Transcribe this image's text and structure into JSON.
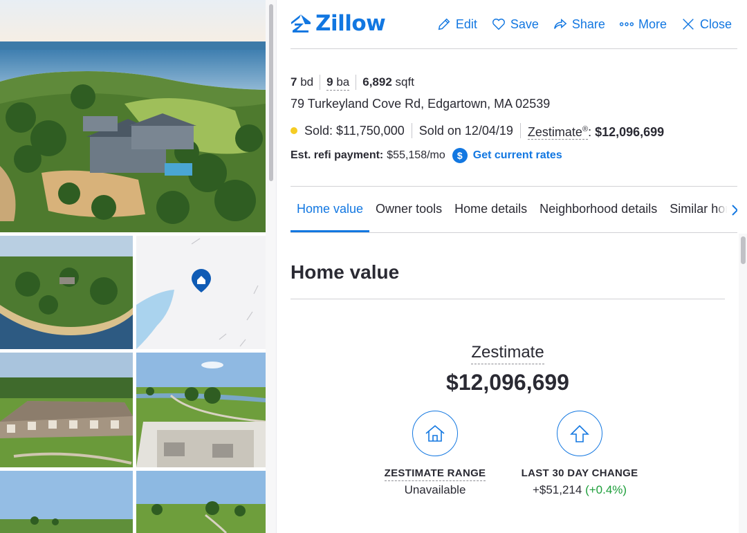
{
  "header": {
    "logo_text": "Zillow",
    "actions": [
      {
        "label": "Edit",
        "icon": "pencil-icon"
      },
      {
        "label": "Save",
        "icon": "heart-icon"
      },
      {
        "label": "Share",
        "icon": "share-arrow-icon"
      },
      {
        "label": "More",
        "icon": "dots-icon"
      },
      {
        "label": "Close",
        "icon": "close-icon"
      }
    ]
  },
  "listing": {
    "beds": "7",
    "beds_unit": "bd",
    "baths": "9",
    "baths_unit": "ba",
    "sqft": "6,892",
    "sqft_unit": "sqft",
    "address": "79 Turkeyland Cove Rd, Edgartown, MA 02539",
    "status_color": "#f5cc24",
    "sold_text": "Sold: $11,750,000",
    "sold_date_text": "Sold on 12/04/19",
    "zestimate_label": "Zestimate",
    "zestimate_reg": "®",
    "zestimate_colon": ":",
    "zestimate_value": "$12,096,699",
    "refi_label": "Est. refi payment:",
    "refi_value": "$55,158/mo",
    "rates_icon_glyph": "$",
    "rates_link": "Get current rates"
  },
  "tabs": [
    {
      "label": "Home value",
      "active": true
    },
    {
      "label": "Owner tools"
    },
    {
      "label": "Home details"
    },
    {
      "label": "Neighborhood details"
    },
    {
      "label": "Similar homes"
    }
  ],
  "home_value": {
    "title": "Home value",
    "zestimate_label": "Zestimate",
    "zestimate_value": "$12,096,699",
    "range_label": "ZESTIMATE RANGE",
    "range_value": "Unavailable",
    "change_label": "LAST 30 DAY CHANGE",
    "change_value": "+$51,214",
    "change_pct": "(+0.4%)"
  },
  "colors": {
    "brand_blue": "#1277e1",
    "positive_green": "#1d9e3a",
    "sold_dot": "#f5cc24"
  }
}
